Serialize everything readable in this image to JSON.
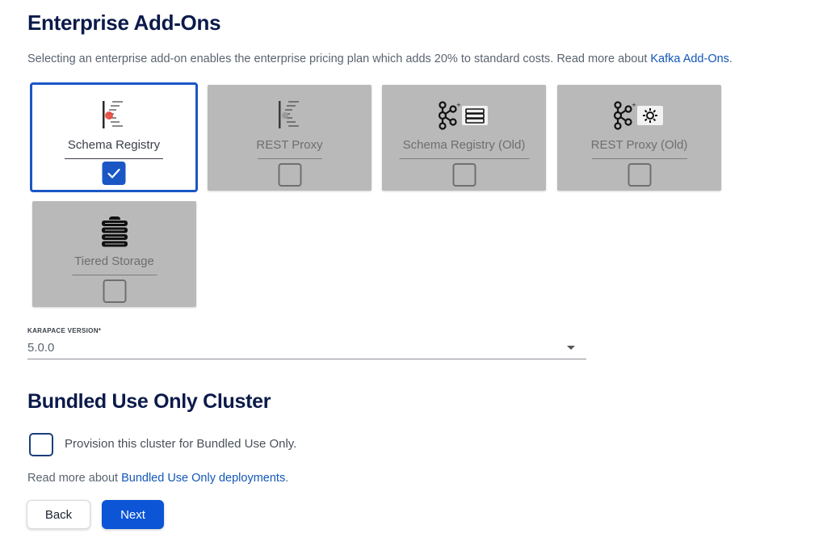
{
  "addons": {
    "title": "Enterprise Add-Ons",
    "intro_text": "Selecting an enterprise add-on enables the enterprise pricing plan which adds 20% to standard costs. Read more about ",
    "intro_link": "Kafka Add-Ons",
    "intro_end": ".",
    "cards": [
      {
        "label": "Schema Registry",
        "icon": "schema-registry-icon",
        "selected": true
      },
      {
        "label": "REST Proxy",
        "icon": "rest-proxy-icon",
        "selected": false
      },
      {
        "label": "Schema Registry (Old)",
        "icon": "kafka-schema-registry-old-icon",
        "selected": false
      },
      {
        "label": "REST Proxy (Old)",
        "icon": "kafka-rest-proxy-old-icon",
        "selected": false
      },
      {
        "label": "Tiered Storage",
        "icon": "tiered-storage-icon",
        "selected": false
      }
    ]
  },
  "karapace": {
    "label": "KARAPACE VERSION*",
    "value": "5.0.0"
  },
  "bundled": {
    "title": "Bundled Use Only Cluster",
    "checkbox_label": "Provision this cluster for Bundled Use Only.",
    "checked": false,
    "readmore_text": "Read more about ",
    "readmore_link": "Bundled Use Only deployments",
    "readmore_end": "."
  },
  "actions": {
    "back_label": "Back",
    "next_label": "Next"
  },
  "colors": {
    "accent": "#1a57c5",
    "heading": "#0b1a4a",
    "link": "#1357b8",
    "disabled_card": "#b9b9b9"
  }
}
